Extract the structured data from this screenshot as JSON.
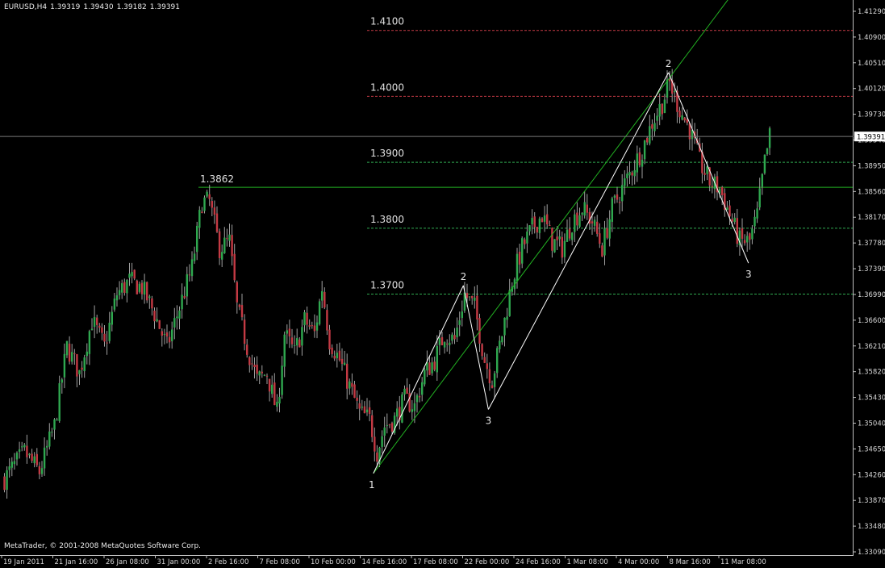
{
  "header": {
    "symbol": "EURUSD,H4",
    "open": "1.39319",
    "high": "1.39430",
    "low": "1.39182",
    "close": "1.39391"
  },
  "copyright": "MetaTrader, © 2001-2008 MetaQuotes Software Corp.",
  "colors": {
    "background": "#000000",
    "bull": "#2fa84f",
    "bear": "#c43a44",
    "wick": "#a0a0a0",
    "axis_text": "#d8d8d8",
    "level_red": "#c43a44",
    "level_green": "#2fa84f",
    "trend": "#22b022",
    "wave": "#ffffff"
  },
  "chart_data": {
    "type": "candlestick",
    "timeframe": "H4",
    "x_tick_labels": [
      "19 Jan 2011",
      "21 Jan 16:00",
      "26 Jan 08:00",
      "31 Jan 00:00",
      "2 Feb 16:00",
      "7 Feb 08:00",
      "10 Feb 00:00",
      "14 Feb 16:00",
      "17 Feb 08:00",
      "22 Feb 00:00",
      "24 Feb 16:00",
      "1 Mar 08:00",
      "4 Mar 00:00",
      "8 Mar 16:00",
      "11 Mar 08:00"
    ],
    "y_tick_labels": [
      "1.41290",
      "1.40900",
      "1.40510",
      "1.40120",
      "1.39730",
      "1.39340",
      "1.38950",
      "1.38560",
      "1.38170",
      "1.37780",
      "1.37390",
      "1.36990",
      "1.36600",
      "1.36210",
      "1.35820",
      "1.35430",
      "1.35040",
      "1.34650",
      "1.34260",
      "1.33870",
      "1.33480",
      "1.33090"
    ],
    "ylim": [
      1.3309,
      1.4129
    ],
    "current_price": "1.39391",
    "levels": [
      {
        "label": "1.4100",
        "value": 1.41,
        "color": "red"
      },
      {
        "label": "1.4000",
        "value": 1.4,
        "color": "red"
      },
      {
        "label": "1.3900",
        "value": 1.39,
        "color": "green"
      },
      {
        "label": "1.3800",
        "value": 1.38,
        "color": "green"
      },
      {
        "label": "1.3700",
        "value": 1.37,
        "color": "green"
      }
    ],
    "horizontal_line": {
      "label": "1.3862",
      "value": 1.3862
    },
    "trendline": {
      "from": {
        "bar": 148,
        "price": 1.3428
      },
      "to": {
        "bar": 222,
        "price": 1.3803
      }
    },
    "wave_points": [
      {
        "label": "1",
        "bar": 148,
        "price": 1.3428
      },
      {
        "label": "2",
        "bar": 184,
        "price": 1.3713
      },
      {
        "label": "3",
        "bar": 194,
        "price": 1.3525
      },
      {
        "label": "2",
        "bar": 266,
        "price": 1.4036
      },
      {
        "label": "3",
        "bar": 298,
        "price": 1.3747
      }
    ],
    "close_path_anchors": [
      [
        0,
        1.342
      ],
      [
        8,
        1.346
      ],
      [
        14,
        1.343
      ],
      [
        20,
        1.35
      ],
      [
        25,
        1.362
      ],
      [
        30,
        1.358
      ],
      [
        35,
        1.366
      ],
      [
        40,
        1.362
      ],
      [
        45,
        1.37
      ],
      [
        50,
        1.372
      ],
      [
        55,
        1.371
      ],
      [
        60,
        1.367
      ],
      [
        65,
        1.362
      ],
      [
        70,
        1.368
      ],
      [
        75,
        1.374
      ],
      [
        79,
        1.384
      ],
      [
        82,
        1.384
      ],
      [
        86,
        1.377
      ],
      [
        90,
        1.378
      ],
      [
        93,
        1.368
      ],
      [
        97,
        1.362
      ],
      [
        101,
        1.357
      ],
      [
        105,
        1.358
      ],
      [
        109,
        1.352
      ],
      [
        112,
        1.364
      ],
      [
        116,
        1.361
      ],
      [
        120,
        1.366
      ],
      [
        124,
        1.364
      ],
      [
        127,
        1.371
      ],
      [
        130,
        1.363
      ],
      [
        134,
        1.36
      ],
      [
        138,
        1.356
      ],
      [
        142,
        1.352
      ],
      [
        146,
        1.351
      ],
      [
        149,
        1.346
      ],
      [
        152,
        1.35
      ],
      [
        156,
        1.351
      ],
      [
        160,
        1.354
      ],
      [
        164,
        1.353
      ],
      [
        168,
        1.358
      ],
      [
        172,
        1.36
      ],
      [
        176,
        1.364
      ],
      [
        180,
        1.363
      ],
      [
        184,
        1.37
      ],
      [
        188,
        1.368
      ],
      [
        192,
        1.36
      ],
      [
        195,
        1.357
      ],
      [
        199,
        1.364
      ],
      [
        203,
        1.372
      ],
      [
        207,
        1.377
      ],
      [
        211,
        1.38
      ],
      [
        215,
        1.382
      ],
      [
        219,
        1.378
      ],
      [
        223,
        1.377
      ],
      [
        227,
        1.381
      ],
      [
        231,
        1.383
      ],
      [
        235,
        1.381
      ],
      [
        239,
        1.377
      ],
      [
        243,
        1.383
      ],
      [
        247,
        1.386
      ],
      [
        251,
        1.389
      ],
      [
        255,
        1.392
      ],
      [
        259,
        1.396
      ],
      [
        263,
        1.399
      ],
      [
        266,
        1.402
      ],
      [
        270,
        1.398
      ],
      [
        274,
        1.395
      ],
      [
        278,
        1.39
      ],
      [
        282,
        1.387
      ],
      [
        286,
        1.386
      ],
      [
        290,
        1.382
      ],
      [
        294,
        1.378
      ],
      [
        298,
        1.378
      ],
      [
        301,
        1.382
      ],
      [
        304,
        1.39
      ],
      [
        306,
        1.3939
      ]
    ]
  }
}
